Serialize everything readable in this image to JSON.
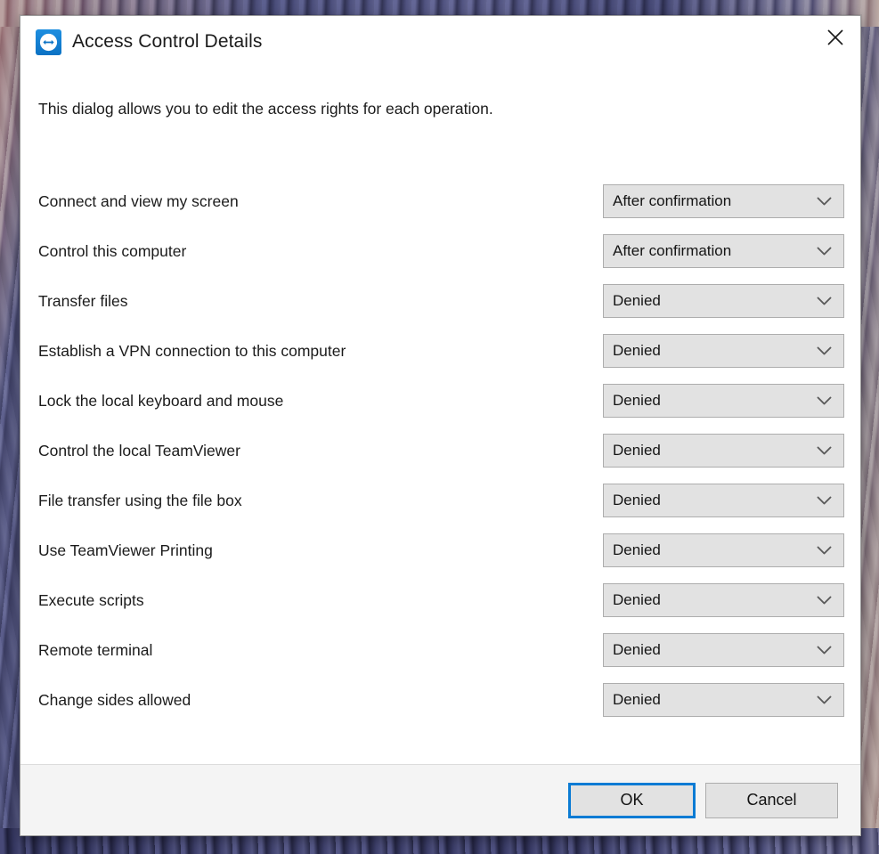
{
  "window": {
    "title": "Access Control Details",
    "logo_icon": "teamviewer-logo-icon",
    "close_icon": "close-icon"
  },
  "body": {
    "intro_text": "This dialog allows you to edit the access rights for each operation."
  },
  "permissions": [
    {
      "label": "Connect and view my screen",
      "value": "After confirmation"
    },
    {
      "label": "Control this computer",
      "value": "After confirmation"
    },
    {
      "label": "Transfer files",
      "value": "Denied"
    },
    {
      "label": "Establish a VPN connection to this computer",
      "value": "Denied"
    },
    {
      "label": "Lock the local keyboard and mouse",
      "value": "Denied"
    },
    {
      "label": "Control the local TeamViewer",
      "value": "Denied"
    },
    {
      "label": "File transfer using the file box",
      "value": "Denied"
    },
    {
      "label": "Use TeamViewer Printing",
      "value": "Denied"
    },
    {
      "label": "Execute scripts",
      "value": "Denied"
    },
    {
      "label": "Remote terminal",
      "value": "Denied"
    },
    {
      "label": "Change sides allowed",
      "value": "Denied"
    }
  ],
  "dropdown_icon": "chevron-down-icon",
  "footer": {
    "ok_label": "OK",
    "cancel_label": "Cancel"
  },
  "colors": {
    "accent_blue": "#0a7bd4",
    "logo_blue": "#0b72c4",
    "control_fill": "#e2e2e2",
    "control_border": "#adadad",
    "footer_bg": "#f4f4f4",
    "text": "#1b1b1b"
  }
}
